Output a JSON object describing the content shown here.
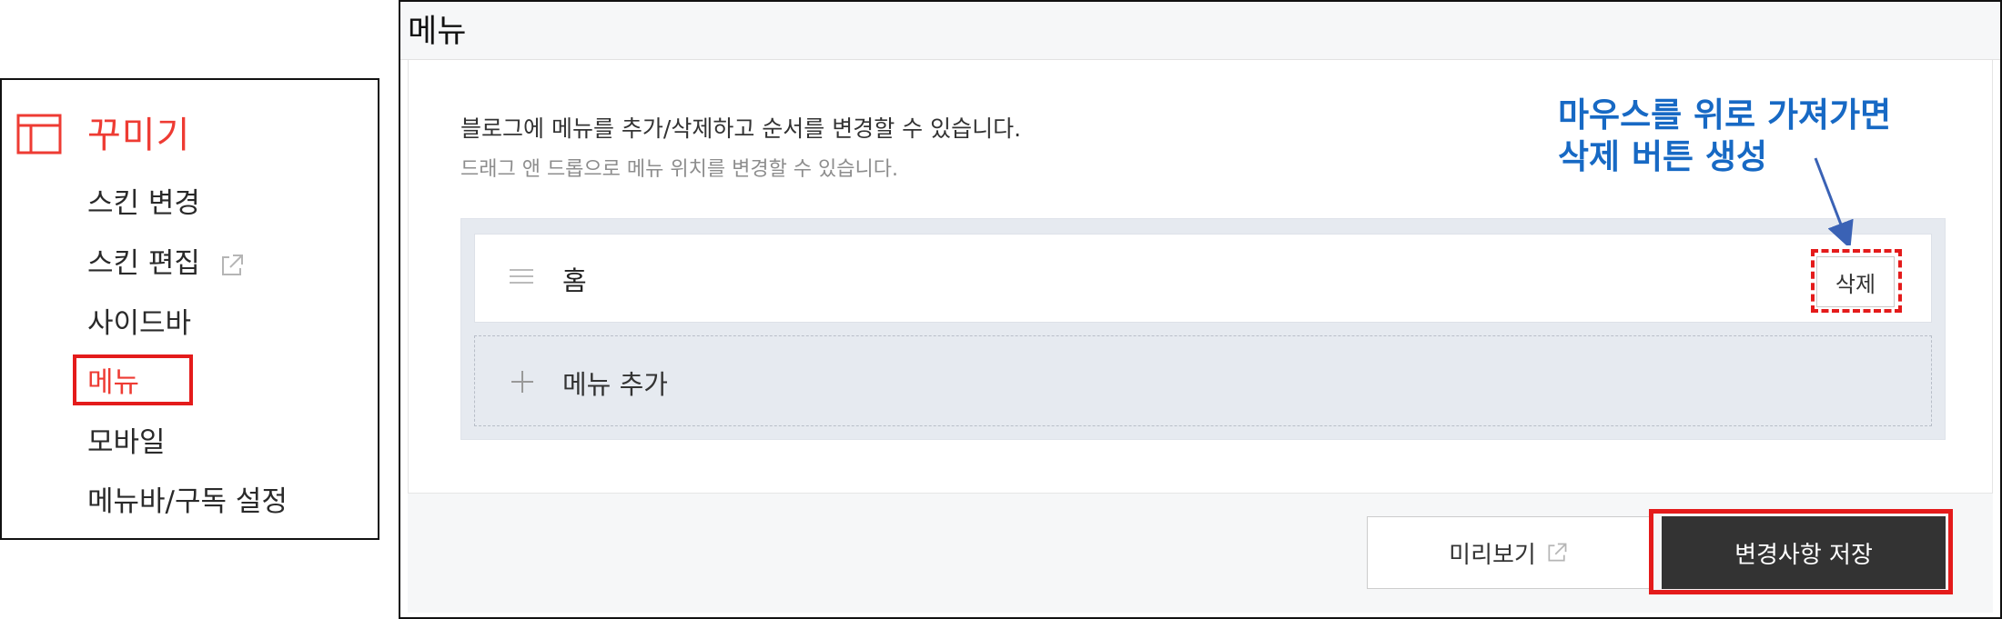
{
  "sidebar": {
    "title": "꾸미기",
    "items": [
      {
        "label": "스킨 변경"
      },
      {
        "label": "스킨 편집",
        "external_icon": "external-link-icon"
      },
      {
        "label": "사이드바"
      },
      {
        "label": "메뉴",
        "active": true
      },
      {
        "label": "모바일"
      },
      {
        "label": "메뉴바/구독 설정"
      }
    ],
    "icon": "layout-icon",
    "accent_color": "#ee3b33"
  },
  "panel": {
    "title": "메뉴",
    "description": "블로그에 메뉴를 추가/삭제하고 순서를 변경할 수 있습니다.",
    "hint": "드래그 앤 드롭으로 메뉴 위치를 변경할 수 있습니다.",
    "menu_items": [
      {
        "label": "홈",
        "drag_icon": "drag-handle-icon",
        "delete_label": "삭제"
      }
    ],
    "add_label": "메뉴 추가",
    "preview_label": "미리보기",
    "save_label": "변경사항 저장"
  },
  "annotation": {
    "line1": "마우스를 위로 가져가면",
    "line2": "삭제 버튼 생성",
    "color": "#1769c4",
    "highlight_color": "#e41b1b"
  }
}
